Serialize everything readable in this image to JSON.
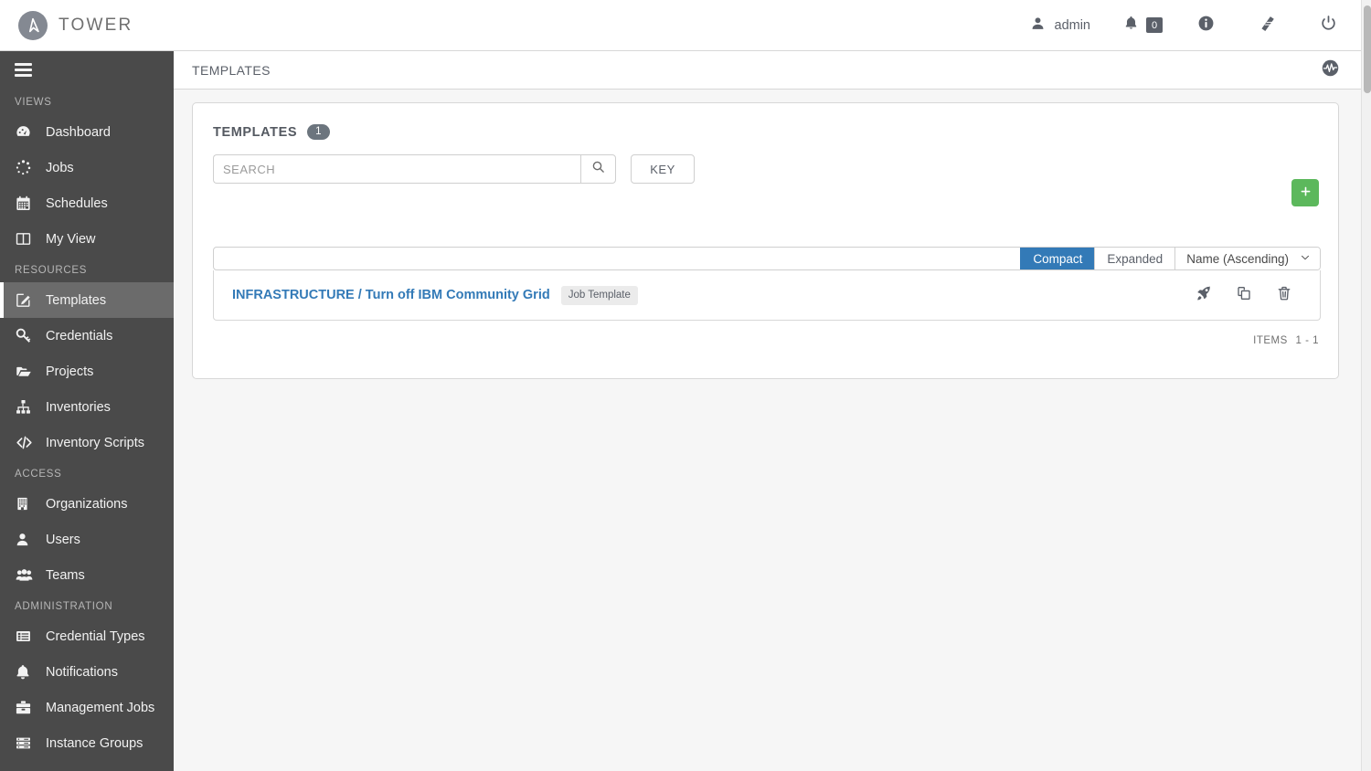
{
  "brand": {
    "name": "TOWER",
    "logo_icon": "ansible-logo-icon",
    "logo_color": "#848992"
  },
  "topnav": {
    "user_icon": "user-icon",
    "user_name": "admin",
    "bell_icon": "bell-icon",
    "notification_count": "0",
    "info_icon": "info-circle-icon",
    "docs_icon": "book-icon",
    "logout_icon": "power-off-icon"
  },
  "sidebar": {
    "hamburger_icon": "hamburger-menu-icon",
    "sections": [
      {
        "label": "VIEWS",
        "items": [
          {
            "label": "Dashboard",
            "icon": "dashboard-gauge-icon",
            "active": false
          },
          {
            "label": "Jobs",
            "icon": "jobs-dots-icon",
            "active": false
          },
          {
            "label": "Schedules",
            "icon": "calendar-icon",
            "active": false
          },
          {
            "label": "My View",
            "icon": "columns-icon",
            "active": false
          }
        ]
      },
      {
        "label": "RESOURCES",
        "items": [
          {
            "label": "Templates",
            "icon": "pencil-square-icon",
            "active": true
          },
          {
            "label": "Credentials",
            "icon": "key-icon",
            "active": false
          },
          {
            "label": "Projects",
            "icon": "folder-open-icon",
            "active": false
          },
          {
            "label": "Inventories",
            "icon": "sitemap-icon",
            "active": false
          },
          {
            "label": "Inventory Scripts",
            "icon": "code-icon",
            "active": false
          }
        ]
      },
      {
        "label": "ACCESS",
        "items": [
          {
            "label": "Organizations",
            "icon": "building-icon",
            "active": false
          },
          {
            "label": "Users",
            "icon": "user-icon",
            "active": false
          },
          {
            "label": "Teams",
            "icon": "users-group-icon",
            "active": false
          }
        ]
      },
      {
        "label": "ADMINISTRATION",
        "items": [
          {
            "label": "Credential Types",
            "icon": "list-alt-icon",
            "active": false
          },
          {
            "label": "Notifications",
            "icon": "bell-icon",
            "active": false
          },
          {
            "label": "Management Jobs",
            "icon": "briefcase-icon",
            "active": false
          },
          {
            "label": "Instance Groups",
            "icon": "server-stack-icon",
            "active": false
          }
        ]
      }
    ]
  },
  "breadcrumb": {
    "title": "TEMPLATES",
    "activity_stream_icon": "activity-stream-icon"
  },
  "card": {
    "title": "TEMPLATES",
    "count": "1",
    "search": {
      "placeholder": "SEARCH",
      "value": "",
      "search_icon": "search-icon"
    },
    "key_button": "KEY",
    "add_button": {
      "label": "+",
      "icon": "plus-icon",
      "color": "#5cb85c"
    },
    "toolbar": {
      "filter_value": "",
      "view_modes": [
        {
          "label": "Compact",
          "selected": true
        },
        {
          "label": "Expanded",
          "selected": false
        }
      ],
      "sort": {
        "value": "Name (Ascending)",
        "chevron_icon": "chevron-down-icon"
      },
      "selected_color": "#337ab7"
    },
    "rows": [
      {
        "name": "INFRASTRUCTURE / Turn off IBM Community Grid",
        "badge": "Job Template",
        "actions": [
          {
            "name": "launch",
            "icon": "rocket-icon"
          },
          {
            "name": "copy",
            "icon": "copy-icon"
          },
          {
            "name": "delete",
            "icon": "trash-icon"
          }
        ]
      }
    ],
    "footer": {
      "items_label": "ITEMS",
      "items_range": "1 - 1"
    }
  }
}
